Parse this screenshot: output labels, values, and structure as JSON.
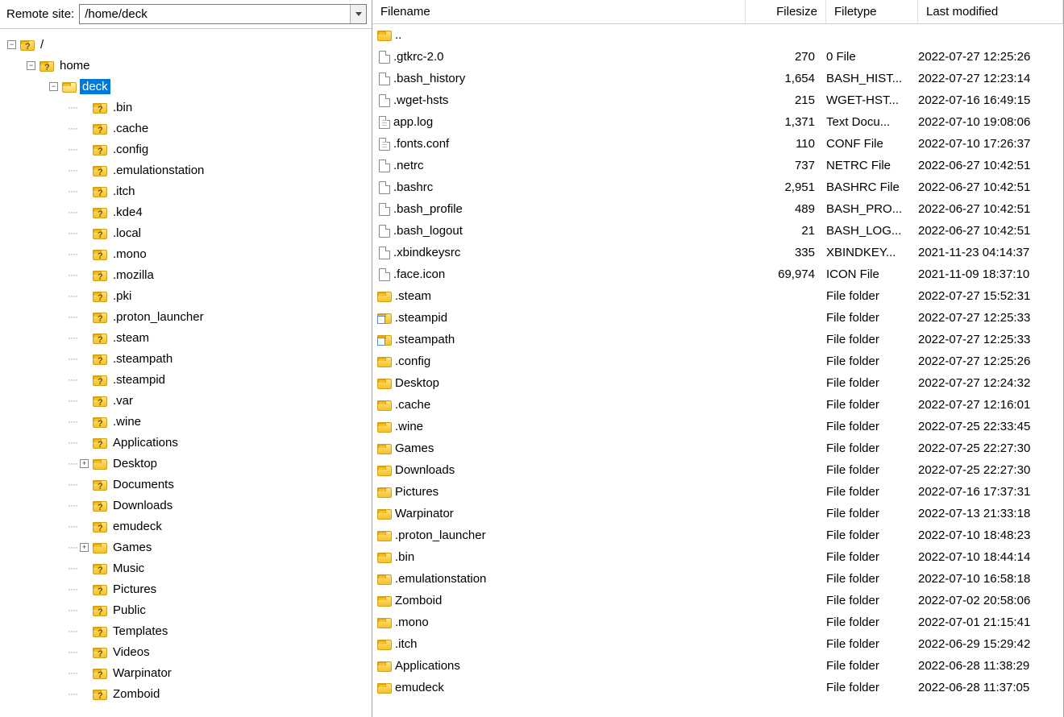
{
  "path_bar": {
    "label": "Remote site:",
    "value": "/home/deck"
  },
  "tree": {
    "root": {
      "label": "/",
      "icon": "folder-q"
    },
    "home": {
      "label": "home",
      "icon": "folder-q"
    },
    "deck": {
      "label": "deck",
      "icon": "folder-open",
      "selected": true
    },
    "children": [
      {
        "label": ".bin",
        "icon": "folder-q"
      },
      {
        "label": ".cache",
        "icon": "folder-q"
      },
      {
        "label": ".config",
        "icon": "folder-q"
      },
      {
        "label": ".emulationstation",
        "icon": "folder-q"
      },
      {
        "label": ".itch",
        "icon": "folder-q"
      },
      {
        "label": ".kde4",
        "icon": "folder-q"
      },
      {
        "label": ".local",
        "icon": "folder-q"
      },
      {
        "label": ".mono",
        "icon": "folder-q"
      },
      {
        "label": ".mozilla",
        "icon": "folder-q"
      },
      {
        "label": ".pki",
        "icon": "folder-q"
      },
      {
        "label": ".proton_launcher",
        "icon": "folder-q"
      },
      {
        "label": ".steam",
        "icon": "folder-q"
      },
      {
        "label": ".steampath",
        "icon": "folder-q"
      },
      {
        "label": ".steampid",
        "icon": "folder-q"
      },
      {
        "label": ".var",
        "icon": "folder-q"
      },
      {
        "label": ".wine",
        "icon": "folder-q"
      },
      {
        "label": "Applications",
        "icon": "folder-q"
      },
      {
        "label": "Desktop",
        "icon": "folder-y",
        "expander": "plus"
      },
      {
        "label": "Documents",
        "icon": "folder-q"
      },
      {
        "label": "Downloads",
        "icon": "folder-q"
      },
      {
        "label": "emudeck",
        "icon": "folder-q"
      },
      {
        "label": "Games",
        "icon": "folder-y",
        "expander": "plus"
      },
      {
        "label": "Music",
        "icon": "folder-q"
      },
      {
        "label": "Pictures",
        "icon": "folder-q"
      },
      {
        "label": "Public",
        "icon": "folder-q"
      },
      {
        "label": "Templates",
        "icon": "folder-q"
      },
      {
        "label": "Videos",
        "icon": "folder-q"
      },
      {
        "label": "Warpinator",
        "icon": "folder-q"
      },
      {
        "label": "Zomboid",
        "icon": "folder-q"
      }
    ]
  },
  "columns": {
    "filename": "Filename",
    "filesize": "Filesize",
    "filetype": "Filetype",
    "modified": "Last modified"
  },
  "files": [
    {
      "name": "..",
      "icon": "folder-y",
      "size": "",
      "type": "",
      "mod": ""
    },
    {
      "name": ".gtkrc-2.0",
      "icon": "file",
      "size": "270",
      "type": "0 File",
      "mod": "2022-07-27 12:25:26"
    },
    {
      "name": ".bash_history",
      "icon": "file",
      "size": "1,654",
      "type": "BASH_HIST...",
      "mod": "2022-07-27 12:23:14"
    },
    {
      "name": ".wget-hsts",
      "icon": "file",
      "size": "215",
      "type": "WGET-HST...",
      "mod": "2022-07-16 16:49:15"
    },
    {
      "name": "app.log",
      "icon": "file-lines",
      "size": "1,371",
      "type": "Text Docu...",
      "mod": "2022-07-10 19:08:06"
    },
    {
      "name": ".fonts.conf",
      "icon": "file-lines",
      "size": "110",
      "type": "CONF File",
      "mod": "2022-07-10 17:26:37"
    },
    {
      "name": ".netrc",
      "icon": "file",
      "size": "737",
      "type": "NETRC File",
      "mod": "2022-06-27 10:42:51"
    },
    {
      "name": ".bashrc",
      "icon": "file",
      "size": "2,951",
      "type": "BASHRC File",
      "mod": "2022-06-27 10:42:51"
    },
    {
      "name": ".bash_profile",
      "icon": "file",
      "size": "489",
      "type": "BASH_PRO...",
      "mod": "2022-06-27 10:42:51"
    },
    {
      "name": ".bash_logout",
      "icon": "file",
      "size": "21",
      "type": "BASH_LOG...",
      "mod": "2022-06-27 10:42:51"
    },
    {
      "name": ".xbindkeysrc",
      "icon": "file",
      "size": "335",
      "type": "XBINDKEY...",
      "mod": "2021-11-23 04:14:37"
    },
    {
      "name": ".face.icon",
      "icon": "file",
      "size": "69,974",
      "type": "ICON File",
      "mod": "2021-11-09 18:37:10"
    },
    {
      "name": ".steam",
      "icon": "folder-y",
      "size": "",
      "type": "File folder",
      "mod": "2022-07-27 15:52:31"
    },
    {
      "name": ".steampid",
      "icon": "folder-shortcut",
      "size": "",
      "type": "File folder",
      "mod": "2022-07-27 12:25:33"
    },
    {
      "name": ".steampath",
      "icon": "folder-shortcut",
      "size": "",
      "type": "File folder",
      "mod": "2022-07-27 12:25:33"
    },
    {
      "name": ".config",
      "icon": "folder-y",
      "size": "",
      "type": "File folder",
      "mod": "2022-07-27 12:25:26"
    },
    {
      "name": "Desktop",
      "icon": "folder-y",
      "size": "",
      "type": "File folder",
      "mod": "2022-07-27 12:24:32"
    },
    {
      "name": ".cache",
      "icon": "folder-y",
      "size": "",
      "type": "File folder",
      "mod": "2022-07-27 12:16:01"
    },
    {
      "name": ".wine",
      "icon": "folder-y",
      "size": "",
      "type": "File folder",
      "mod": "2022-07-25 22:33:45"
    },
    {
      "name": "Games",
      "icon": "folder-y",
      "size": "",
      "type": "File folder",
      "mod": "2022-07-25 22:27:30"
    },
    {
      "name": "Downloads",
      "icon": "folder-y",
      "size": "",
      "type": "File folder",
      "mod": "2022-07-25 22:27:30"
    },
    {
      "name": "Pictures",
      "icon": "folder-y",
      "size": "",
      "type": "File folder",
      "mod": "2022-07-16 17:37:31"
    },
    {
      "name": "Warpinator",
      "icon": "folder-y",
      "size": "",
      "type": "File folder",
      "mod": "2022-07-13 21:33:18"
    },
    {
      "name": ".proton_launcher",
      "icon": "folder-y",
      "size": "",
      "type": "File folder",
      "mod": "2022-07-10 18:48:23"
    },
    {
      "name": ".bin",
      "icon": "folder-y",
      "size": "",
      "type": "File folder",
      "mod": "2022-07-10 18:44:14"
    },
    {
      "name": ".emulationstation",
      "icon": "folder-y",
      "size": "",
      "type": "File folder",
      "mod": "2022-07-10 16:58:18"
    },
    {
      "name": "Zomboid",
      "icon": "folder-y",
      "size": "",
      "type": "File folder",
      "mod": "2022-07-02 20:58:06"
    },
    {
      "name": ".mono",
      "icon": "folder-y",
      "size": "",
      "type": "File folder",
      "mod": "2022-07-01 21:15:41"
    },
    {
      "name": ".itch",
      "icon": "folder-y",
      "size": "",
      "type": "File folder",
      "mod": "2022-06-29 15:29:42"
    },
    {
      "name": "Applications",
      "icon": "folder-y",
      "size": "",
      "type": "File folder",
      "mod": "2022-06-28 11:38:29"
    },
    {
      "name": "emudeck",
      "icon": "folder-y",
      "size": "",
      "type": "File folder",
      "mod": "2022-06-28 11:37:05"
    }
  ]
}
